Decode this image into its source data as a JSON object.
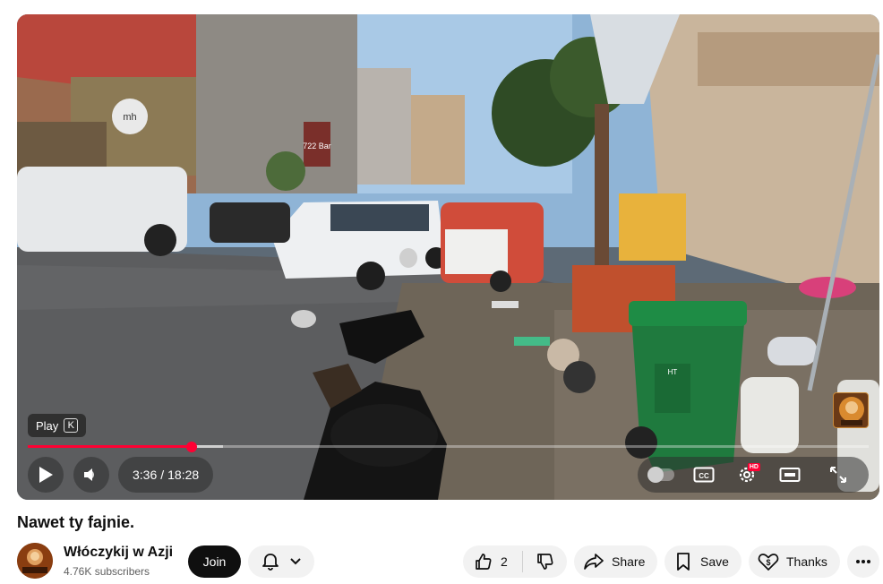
{
  "player": {
    "tooltip": {
      "label": "Play",
      "shortcut": "K"
    },
    "time": {
      "current": "3:36",
      "separator": "/",
      "duration": "18:28"
    },
    "progress": {
      "played_fraction": 0.195,
      "buffered_fraction": 0.232
    },
    "scene_signs": {
      "shop_logo": "mh",
      "bar_sign": "722 Bar",
      "bin_label": "HT"
    },
    "hd_badge": "HD",
    "accent_color": "#ff0033",
    "icons": [
      "play-icon",
      "volume-icon",
      "autoplay-toggle-icon",
      "captions-icon",
      "settings-icon",
      "theater-icon",
      "fullscreen-icon"
    ]
  },
  "video": {
    "title": "Nawet ty fajnie."
  },
  "channel": {
    "name": "Włóczykij w Azji",
    "subscribers": "4.76K subscribers",
    "join_label": "Join",
    "avatar_text": "WŁÓCZYKIJ W AZJI"
  },
  "actions": {
    "like_count": "2",
    "share_label": "Share",
    "save_label": "Save",
    "thanks_label": "Thanks"
  }
}
